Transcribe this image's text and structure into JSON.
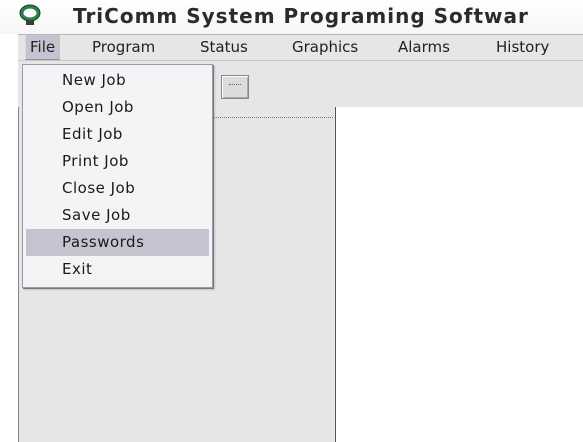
{
  "window": {
    "title": "TriComm System Programing Softwar"
  },
  "menubar": {
    "items": [
      {
        "label": "File",
        "active": true
      },
      {
        "label": "Program"
      },
      {
        "label": "Status"
      },
      {
        "label": "Graphics"
      },
      {
        "label": "Alarms"
      },
      {
        "label": "History"
      }
    ]
  },
  "file_menu": {
    "items": [
      {
        "label": "New Job"
      },
      {
        "label": "Open Job"
      },
      {
        "label": "Edit Job"
      },
      {
        "label": "Print Job"
      },
      {
        "label": "Close Job"
      },
      {
        "label": "Save Job"
      },
      {
        "label": "Passwords",
        "highlighted": true
      },
      {
        "label": "Exit"
      }
    ]
  },
  "colors": {
    "chrome": "#e6e6e6",
    "highlight": "#c4c4d0",
    "menu_bg": "#f4f4f6"
  },
  "icons": {
    "app": "tricomm-logo-icon",
    "toolbar_button": "toolbar-button-icon"
  }
}
